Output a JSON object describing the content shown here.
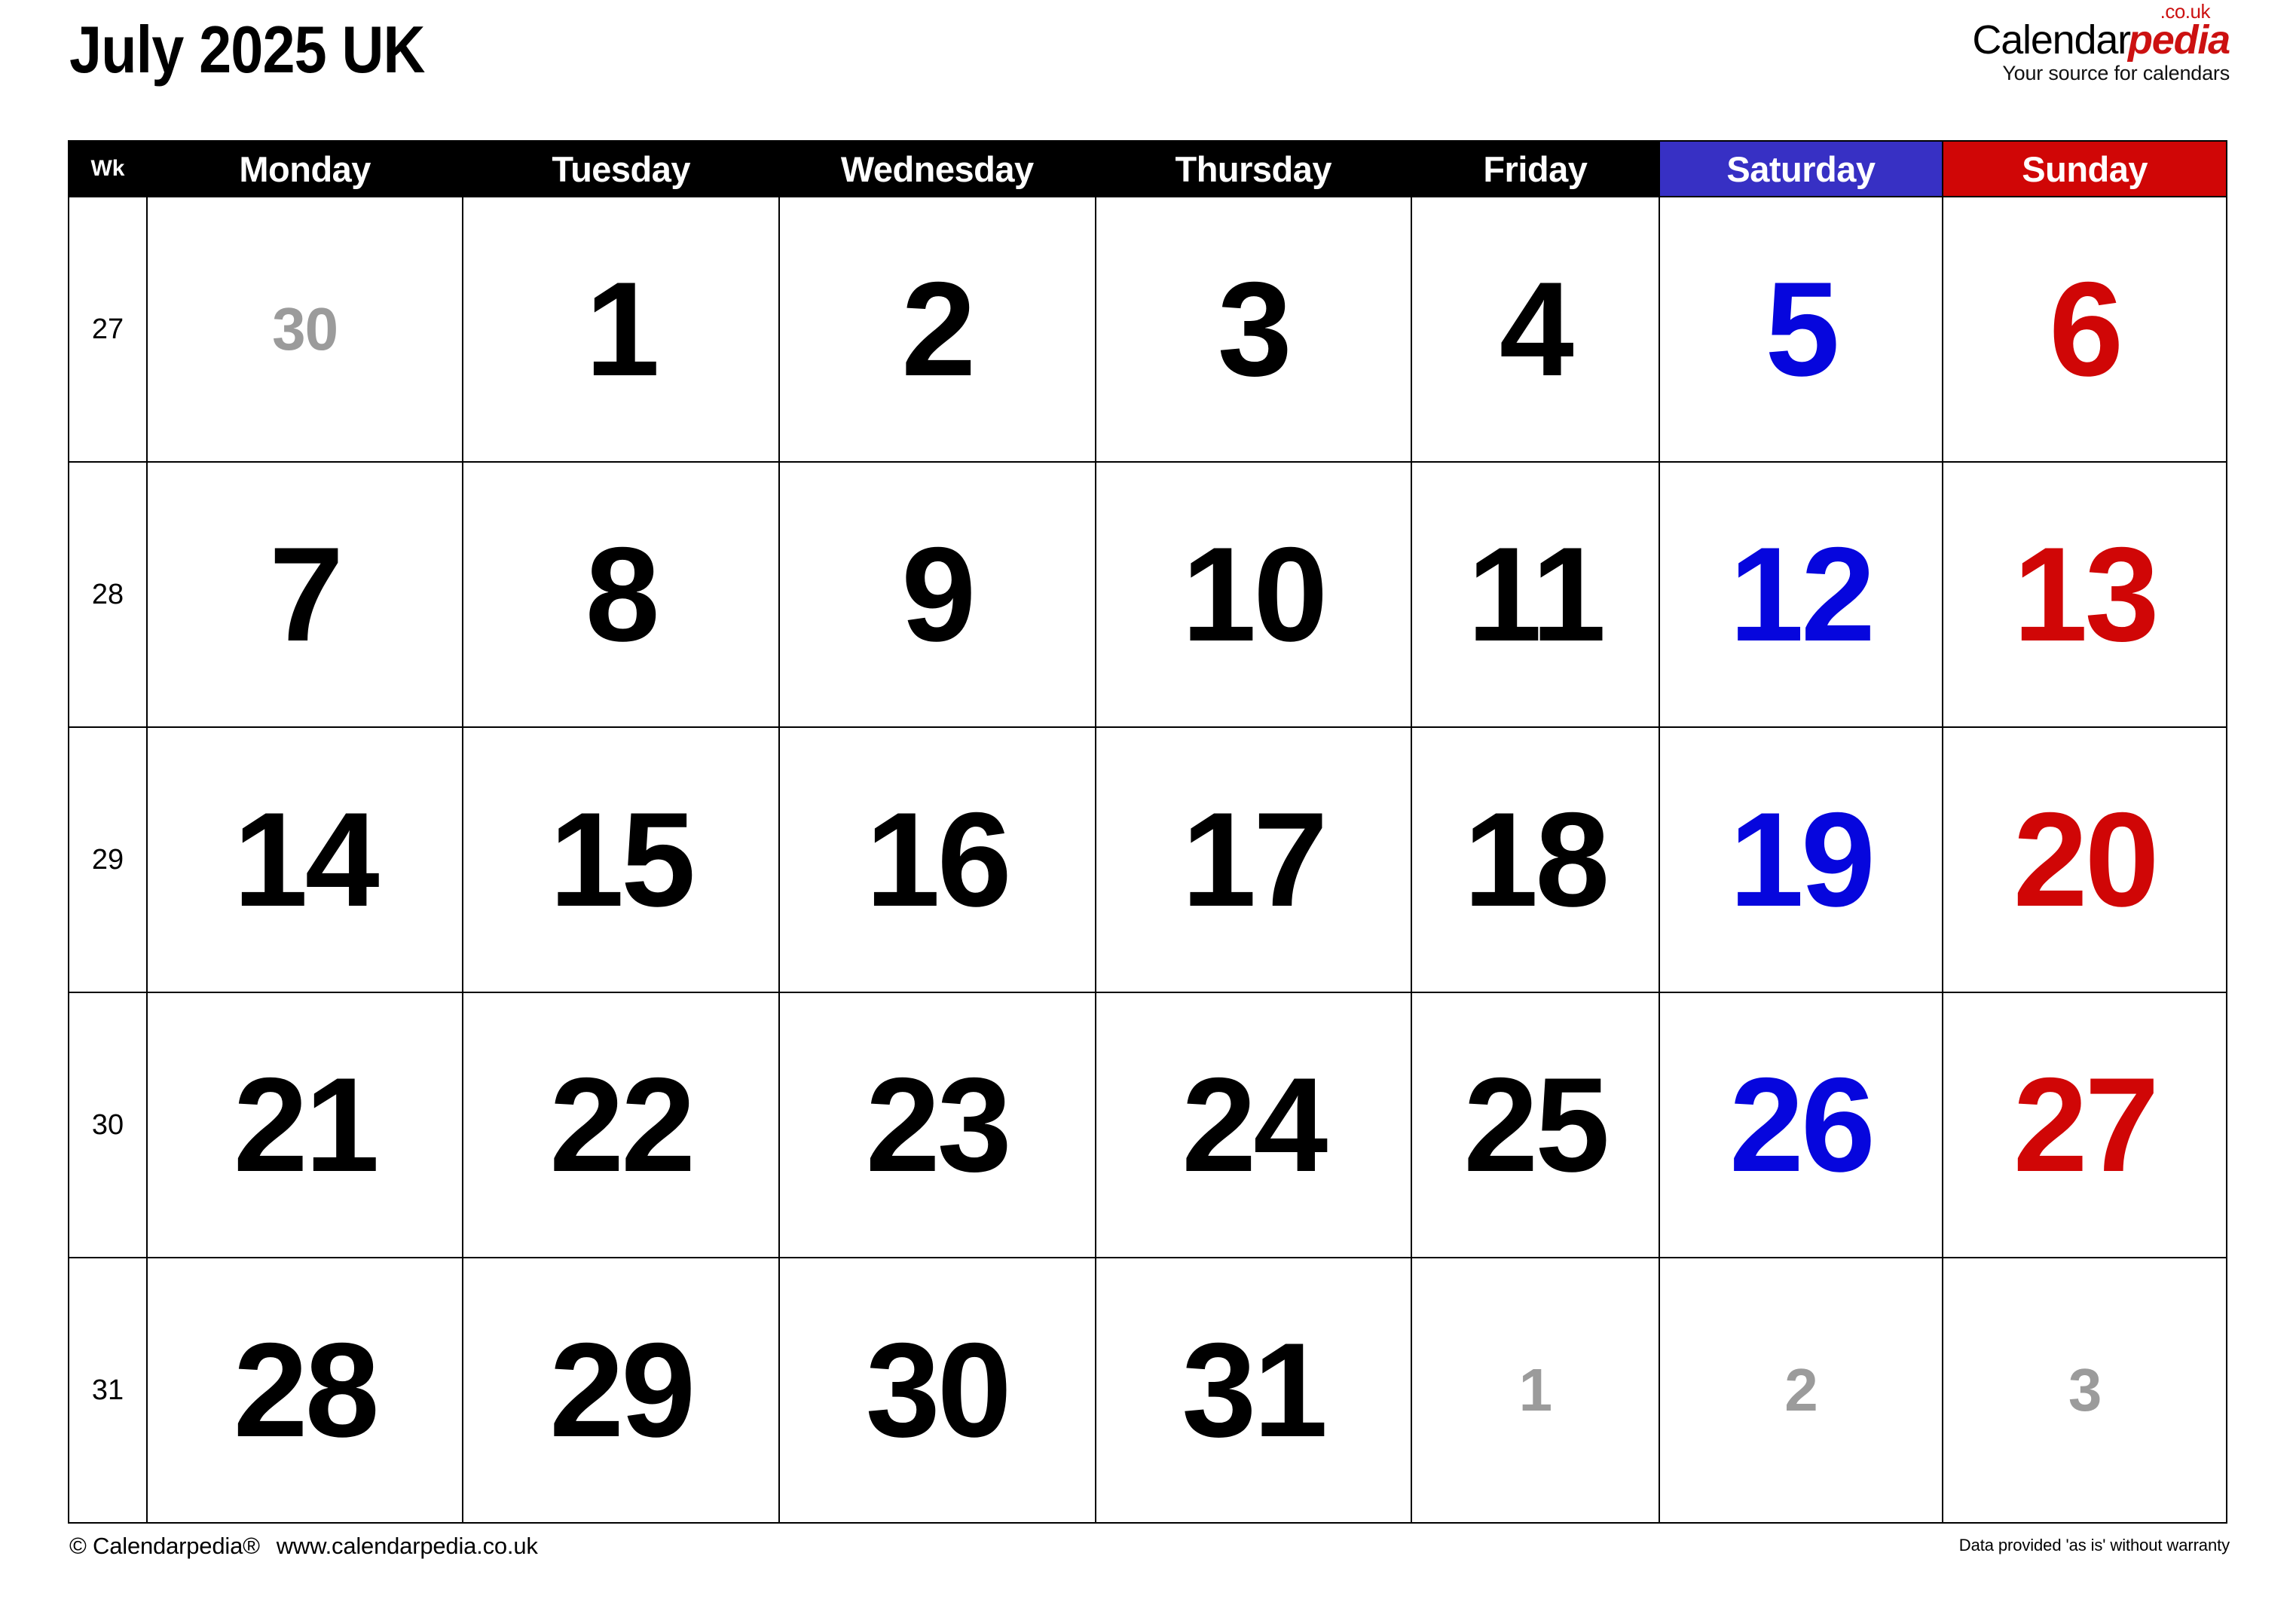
{
  "page": {
    "title": "July 2025 UK"
  },
  "logo": {
    "word_primary": "Calendar",
    "word_accent": "pedia",
    "tld": ".co.uk",
    "tagline": "Your source for calendars",
    "accent_color": "#cc1111"
  },
  "calendar": {
    "month": "July",
    "year": 2025,
    "region": "UK",
    "week_column_label": "Wk",
    "day_headers": [
      {
        "label": "Monday",
        "type": "weekday",
        "bg": "#000000",
        "fg": "#ffffff"
      },
      {
        "label": "Tuesday",
        "type": "weekday",
        "bg": "#000000",
        "fg": "#ffffff"
      },
      {
        "label": "Wednesday",
        "type": "weekday",
        "bg": "#000000",
        "fg": "#ffffff"
      },
      {
        "label": "Thursday",
        "type": "weekday",
        "bg": "#000000",
        "fg": "#ffffff"
      },
      {
        "label": "Friday",
        "type": "weekday",
        "bg": "#000000",
        "fg": "#ffffff"
      },
      {
        "label": "Saturday",
        "type": "saturday",
        "bg": "#3730c4",
        "fg": "#ffffff"
      },
      {
        "label": "Sunday",
        "type": "sunday",
        "bg": "#d00606",
        "fg": "#ffffff"
      }
    ],
    "colors": {
      "saturday_date": "#0606dd",
      "sunday_date": "#d00606",
      "other_month_date": "#9b9b9b",
      "weekday_date": "#000000",
      "header_bg": "#000000",
      "grid_line": "#000000"
    },
    "weeks": [
      {
        "week_number": "27",
        "days": [
          {
            "value": "30",
            "in_month": false,
            "kind": "weekday"
          },
          {
            "value": "1",
            "in_month": true,
            "kind": "weekday"
          },
          {
            "value": "2",
            "in_month": true,
            "kind": "weekday"
          },
          {
            "value": "3",
            "in_month": true,
            "kind": "weekday"
          },
          {
            "value": "4",
            "in_month": true,
            "kind": "weekday"
          },
          {
            "value": "5",
            "in_month": true,
            "kind": "saturday"
          },
          {
            "value": "6",
            "in_month": true,
            "kind": "sunday"
          }
        ]
      },
      {
        "week_number": "28",
        "days": [
          {
            "value": "7",
            "in_month": true,
            "kind": "weekday"
          },
          {
            "value": "8",
            "in_month": true,
            "kind": "weekday"
          },
          {
            "value": "9",
            "in_month": true,
            "kind": "weekday"
          },
          {
            "value": "10",
            "in_month": true,
            "kind": "weekday"
          },
          {
            "value": "11",
            "in_month": true,
            "kind": "weekday"
          },
          {
            "value": "12",
            "in_month": true,
            "kind": "saturday"
          },
          {
            "value": "13",
            "in_month": true,
            "kind": "sunday"
          }
        ]
      },
      {
        "week_number": "29",
        "days": [
          {
            "value": "14",
            "in_month": true,
            "kind": "weekday"
          },
          {
            "value": "15",
            "in_month": true,
            "kind": "weekday"
          },
          {
            "value": "16",
            "in_month": true,
            "kind": "weekday"
          },
          {
            "value": "17",
            "in_month": true,
            "kind": "weekday"
          },
          {
            "value": "18",
            "in_month": true,
            "kind": "weekday"
          },
          {
            "value": "19",
            "in_month": true,
            "kind": "saturday"
          },
          {
            "value": "20",
            "in_month": true,
            "kind": "sunday"
          }
        ]
      },
      {
        "week_number": "30",
        "days": [
          {
            "value": "21",
            "in_month": true,
            "kind": "weekday"
          },
          {
            "value": "22",
            "in_month": true,
            "kind": "weekday"
          },
          {
            "value": "23",
            "in_month": true,
            "kind": "weekday"
          },
          {
            "value": "24",
            "in_month": true,
            "kind": "weekday"
          },
          {
            "value": "25",
            "in_month": true,
            "kind": "weekday"
          },
          {
            "value": "26",
            "in_month": true,
            "kind": "saturday"
          },
          {
            "value": "27",
            "in_month": true,
            "kind": "sunday"
          }
        ]
      },
      {
        "week_number": "31",
        "days": [
          {
            "value": "28",
            "in_month": true,
            "kind": "weekday"
          },
          {
            "value": "29",
            "in_month": true,
            "kind": "weekday"
          },
          {
            "value": "30",
            "in_month": true,
            "kind": "weekday"
          },
          {
            "value": "31",
            "in_month": true,
            "kind": "weekday"
          },
          {
            "value": "1",
            "in_month": false,
            "kind": "weekday"
          },
          {
            "value": "2",
            "in_month": false,
            "kind": "saturday"
          },
          {
            "value": "3",
            "in_month": false,
            "kind": "sunday"
          }
        ]
      }
    ]
  },
  "footer": {
    "copyright": "© Calendarpedia®",
    "website": "www.calendarpedia.co.uk",
    "disclaimer": "Data provided 'as is' without warranty"
  }
}
